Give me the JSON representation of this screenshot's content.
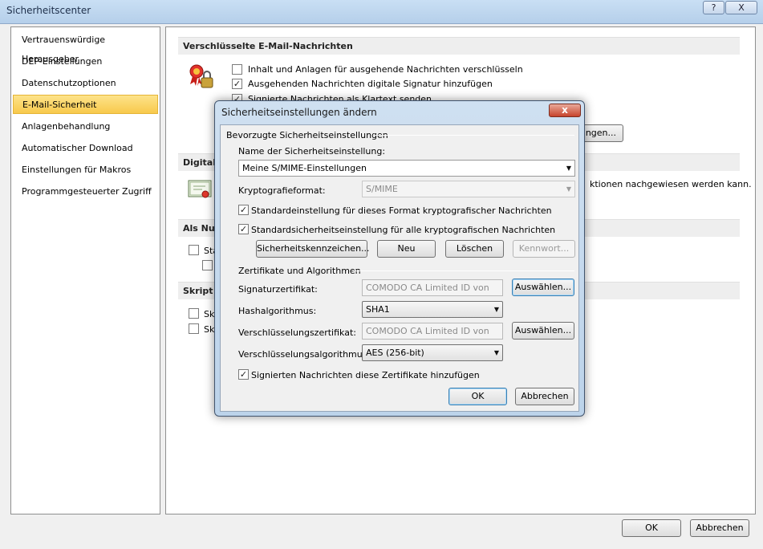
{
  "window": {
    "title": "Sicherheitscenter",
    "help_label": "?",
    "close_label": "X"
  },
  "sidebar": {
    "items": [
      {
        "label": "Vertrauenswürdige Herausgeber"
      },
      {
        "label": "DEP-Einstellungen"
      },
      {
        "label": "Datenschutzoptionen"
      },
      {
        "label": "E-Mail-Sicherheit",
        "active": true
      },
      {
        "label": "Anlagenbehandlung"
      },
      {
        "label": "Automatischer Download"
      },
      {
        "label": "Einstellungen für Makros"
      },
      {
        "label": "Programmgesteuerter Zugriff"
      }
    ]
  },
  "main": {
    "encrypted_section": {
      "title": "Verschlüsselte E-Mail-Nachrichten",
      "options": [
        {
          "label": "Inhalt und Anlagen für ausgehende Nachrichten verschlüsseln",
          "checked": false
        },
        {
          "label": "Ausgehenden Nachrichten digitale Signatur hinzufügen",
          "checked": true
        },
        {
          "label": "Signierte Nachrichten als Klartext senden",
          "checked": true
        }
      ],
      "settings_button_label": "ngen..."
    },
    "digital_ids_section": {
      "title": "Digitale",
      "description_tail": "ktionen nachgewiesen werden kann."
    },
    "plaintext_section": {
      "title": "Als Nur",
      "option_1_partial": "Sta"
    },
    "script_section": {
      "title": "Skript in",
      "option_1_partial": "Sk",
      "option_2_partial": "Sk"
    }
  },
  "dialog": {
    "title": "Sicherheitseinstellungen ändern",
    "close_label": "x",
    "preferred_group": "Bevorzugte Sicherheitseinstellungen",
    "setting_name_label": "Name der Sicherheitseinstellung:",
    "setting_name_value": "Meine S/MIME-Einstellungen",
    "crypto_format_label": "Kryptografieformat:",
    "crypto_format_value": "S/MIME",
    "default_format_label": "Standardeinstellung für dieses Format kryptografischer Nachrichten",
    "default_format_checked": true,
    "default_security_label": "Standardsicherheitseinstellung für alle kryptografischen Nachrichten",
    "default_security_checked": true,
    "security_labels_button": "Sicherheitskennzeichen...",
    "new_button": "Neu",
    "delete_button": "Löschen",
    "password_button": "Kennwort...",
    "certs_group": "Zertifikate und Algorithmen",
    "signing_cert_label": "Signaturzertifikat:",
    "signing_cert_value": "COMODO CA Limited ID von",
    "choose_button_1": "Auswählen...",
    "hash_label": "Hashalgorithmus:",
    "hash_value": "SHA1",
    "encryption_cert_label": "Verschlüsselungszertifikat:",
    "encryption_cert_value": "COMODO CA Limited ID von",
    "choose_button_2": "Auswählen...",
    "encryption_algo_label": "Verschlüsselungsalgorithmus:",
    "encryption_algo_value": "AES (256-bit)",
    "send_certs_label": "Signierten Nachrichten diese Zertifikate hinzufügen",
    "send_certs_checked": true,
    "ok_label": "OK",
    "cancel_label": "Abbrechen"
  },
  "footer": {
    "ok_label": "OK",
    "cancel_label": "Abbrechen"
  }
}
